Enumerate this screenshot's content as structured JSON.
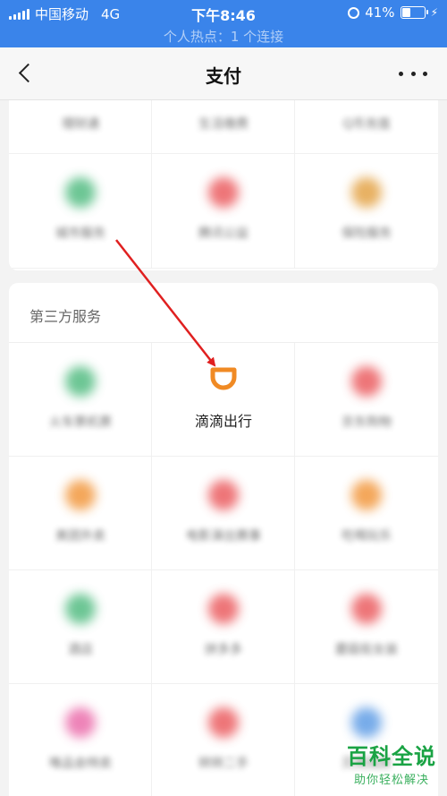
{
  "status_bar": {
    "carrier": "中国移动",
    "network": "4G",
    "time": "下午8:46",
    "battery": "41%",
    "battery_level": 0.41,
    "hotspot": "个人热点：1 个连接"
  },
  "navbar": {
    "title": "支付",
    "back_icon": "chevron-left-icon",
    "more_icon": "more-dots-icon"
  },
  "colors": {
    "status_bar": "#3a84ea",
    "didi_orange": "#f08a24",
    "arrow_red": "#e02020",
    "watermark_green": "#1aa344"
  },
  "top_section": {
    "items": [
      {
        "label": "理财通",
        "color": "#9aa0a6"
      },
      {
        "label": "生活缴费",
        "color": "#9aa0a6"
      },
      {
        "label": "Q币充值",
        "color": "#9aa0a6"
      },
      {
        "label": "城市服务",
        "color": "#3cb371"
      },
      {
        "label": "腾讯公益",
        "color": "#e8474b"
      },
      {
        "label": "保险服务",
        "color": "#e0972e"
      }
    ]
  },
  "third_party": {
    "title": "第三方服务",
    "items": [
      {
        "label": "火车票机票",
        "color": "#3cb371"
      },
      {
        "label": "滴滴出行",
        "color": "#f08a24",
        "highlight": true
      },
      {
        "label": "京东购物",
        "color": "#e8474b"
      },
      {
        "label": "美团外卖",
        "color": "#f08a24"
      },
      {
        "label": "电影演出赛事",
        "color": "#e8474b"
      },
      {
        "label": "吃喝玩乐",
        "color": "#f08a24"
      },
      {
        "label": "酒店",
        "color": "#3cb371"
      },
      {
        "label": "拼多多",
        "color": "#e8474b"
      },
      {
        "label": "蘑菇街女装",
        "color": "#e8474b"
      },
      {
        "label": "唯品会特卖",
        "color": "#e85aa0"
      },
      {
        "label": "转转二手",
        "color": "#e8474b"
      },
      {
        "label": "贝壳找房",
        "color": "#4a90e2"
      }
    ]
  },
  "watermark": {
    "title": "百科全说",
    "subtitle": "助你轻松解决"
  }
}
